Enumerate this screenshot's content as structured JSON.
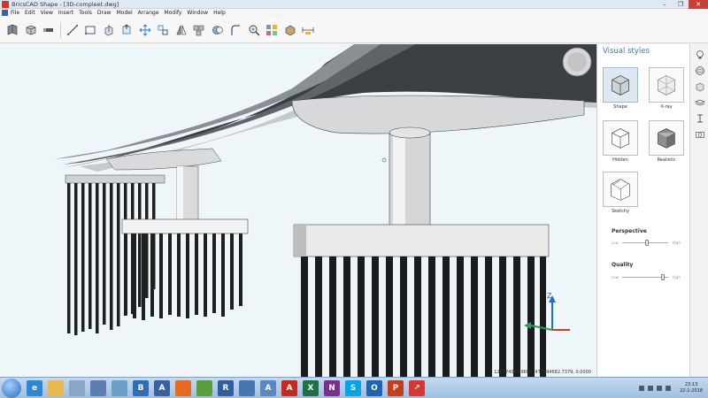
{
  "window": {
    "title": "BricsCAD Shape - [3D-compleet.dwg]",
    "controls": {
      "minimize": "–",
      "maximize": "❐",
      "close": "✕"
    }
  },
  "menu": {
    "items": [
      {
        "label": "File"
      },
      {
        "label": "Edit"
      },
      {
        "label": "View"
      },
      {
        "label": "Insert"
      },
      {
        "label": "Tools"
      },
      {
        "label": "Draw"
      },
      {
        "label": "Model"
      },
      {
        "label": "Arrange"
      },
      {
        "label": "Modify"
      },
      {
        "label": "Window"
      },
      {
        "label": "Help"
      }
    ]
  },
  "toolbar": {
    "tools": [
      "book-icon",
      "solid-box-icon",
      "bar-icon",
      "line-icon",
      "rectangle-icon",
      "extrude-icon",
      "push-pull-icon",
      "move-icon",
      "rotate-icon",
      "mirror-icon",
      "array-icon",
      "subtract-icon",
      "fillet-icon",
      "zoom-icon",
      "library-icon",
      "material-icon",
      "dimension-icon"
    ]
  },
  "viewport": {
    "background": "#eef6fa",
    "coordinates": "124874080.9600, 477894682.7379, 0.0000",
    "ucs": {
      "z_label": "Z"
    }
  },
  "panel": {
    "title": "Visual styles",
    "styles": [
      {
        "label": "Shape",
        "selected": true
      },
      {
        "label": "X-ray",
        "selected": false
      },
      {
        "label": "Hidden",
        "selected": false
      },
      {
        "label": "Realistic",
        "selected": false
      },
      {
        "label": "Sketchy",
        "selected": false
      }
    ],
    "perspective": {
      "label": "Perspective",
      "min": "Low",
      "max": "High",
      "value": 0.55
    },
    "quality": {
      "label": "Quality",
      "min": "Low",
      "max": "High",
      "value": 0.92
    }
  },
  "strip": {
    "buttons": [
      "lightbulb-icon",
      "sphere-icon",
      "cube-icon",
      "layers-icon",
      "beam-icon",
      "camera-icon"
    ]
  },
  "taskbar": {
    "apps": [
      {
        "name": "ie-icon",
        "color": "#2e86d6",
        "glyph": "e"
      },
      {
        "name": "folder-icon",
        "color": "#e8b84a",
        "glyph": ""
      },
      {
        "name": "paint-icon",
        "color": "#8aa6c6",
        "glyph": ""
      },
      {
        "name": "sketch-icon",
        "color": "#5a7fb0",
        "glyph": ""
      },
      {
        "name": "image-icon",
        "color": "#6aa0c8",
        "glyph": ""
      },
      {
        "name": "bricscad-icon",
        "color": "#2f6db5",
        "glyph": "B"
      },
      {
        "name": "archicad-icon",
        "color": "#3b5fa0",
        "glyph": "A"
      },
      {
        "name": "firefox-icon",
        "color": "#e56a1e",
        "glyph": ""
      },
      {
        "name": "chrome-icon",
        "color": "#5a9e3c",
        "glyph": ""
      },
      {
        "name": "revit-icon",
        "color": "#2f5f9e",
        "glyph": "R"
      },
      {
        "name": "autodesk-icon",
        "color": "#4577b0",
        "glyph": ""
      },
      {
        "name": "app-icon",
        "color": "#5c86c0",
        "glyph": "A"
      },
      {
        "name": "acrobat-icon",
        "color": "#c42b1c",
        "glyph": "A"
      },
      {
        "name": "excel-icon",
        "color": "#1e7145",
        "glyph": "X"
      },
      {
        "name": "onenote-icon",
        "color": "#7a2f8f",
        "glyph": "N"
      },
      {
        "name": "skype-icon",
        "color": "#00a6e6",
        "glyph": "S"
      },
      {
        "name": "outlook-icon",
        "color": "#1e64b0",
        "glyph": "O"
      },
      {
        "name": "powerpoint-icon",
        "color": "#c43e1c",
        "glyph": "P"
      },
      {
        "name": "bricscad-shape-icon",
        "color": "#d7372f",
        "glyph": "↗"
      }
    ],
    "clock_time": "23:13",
    "clock_date": "22-1-2018"
  }
}
